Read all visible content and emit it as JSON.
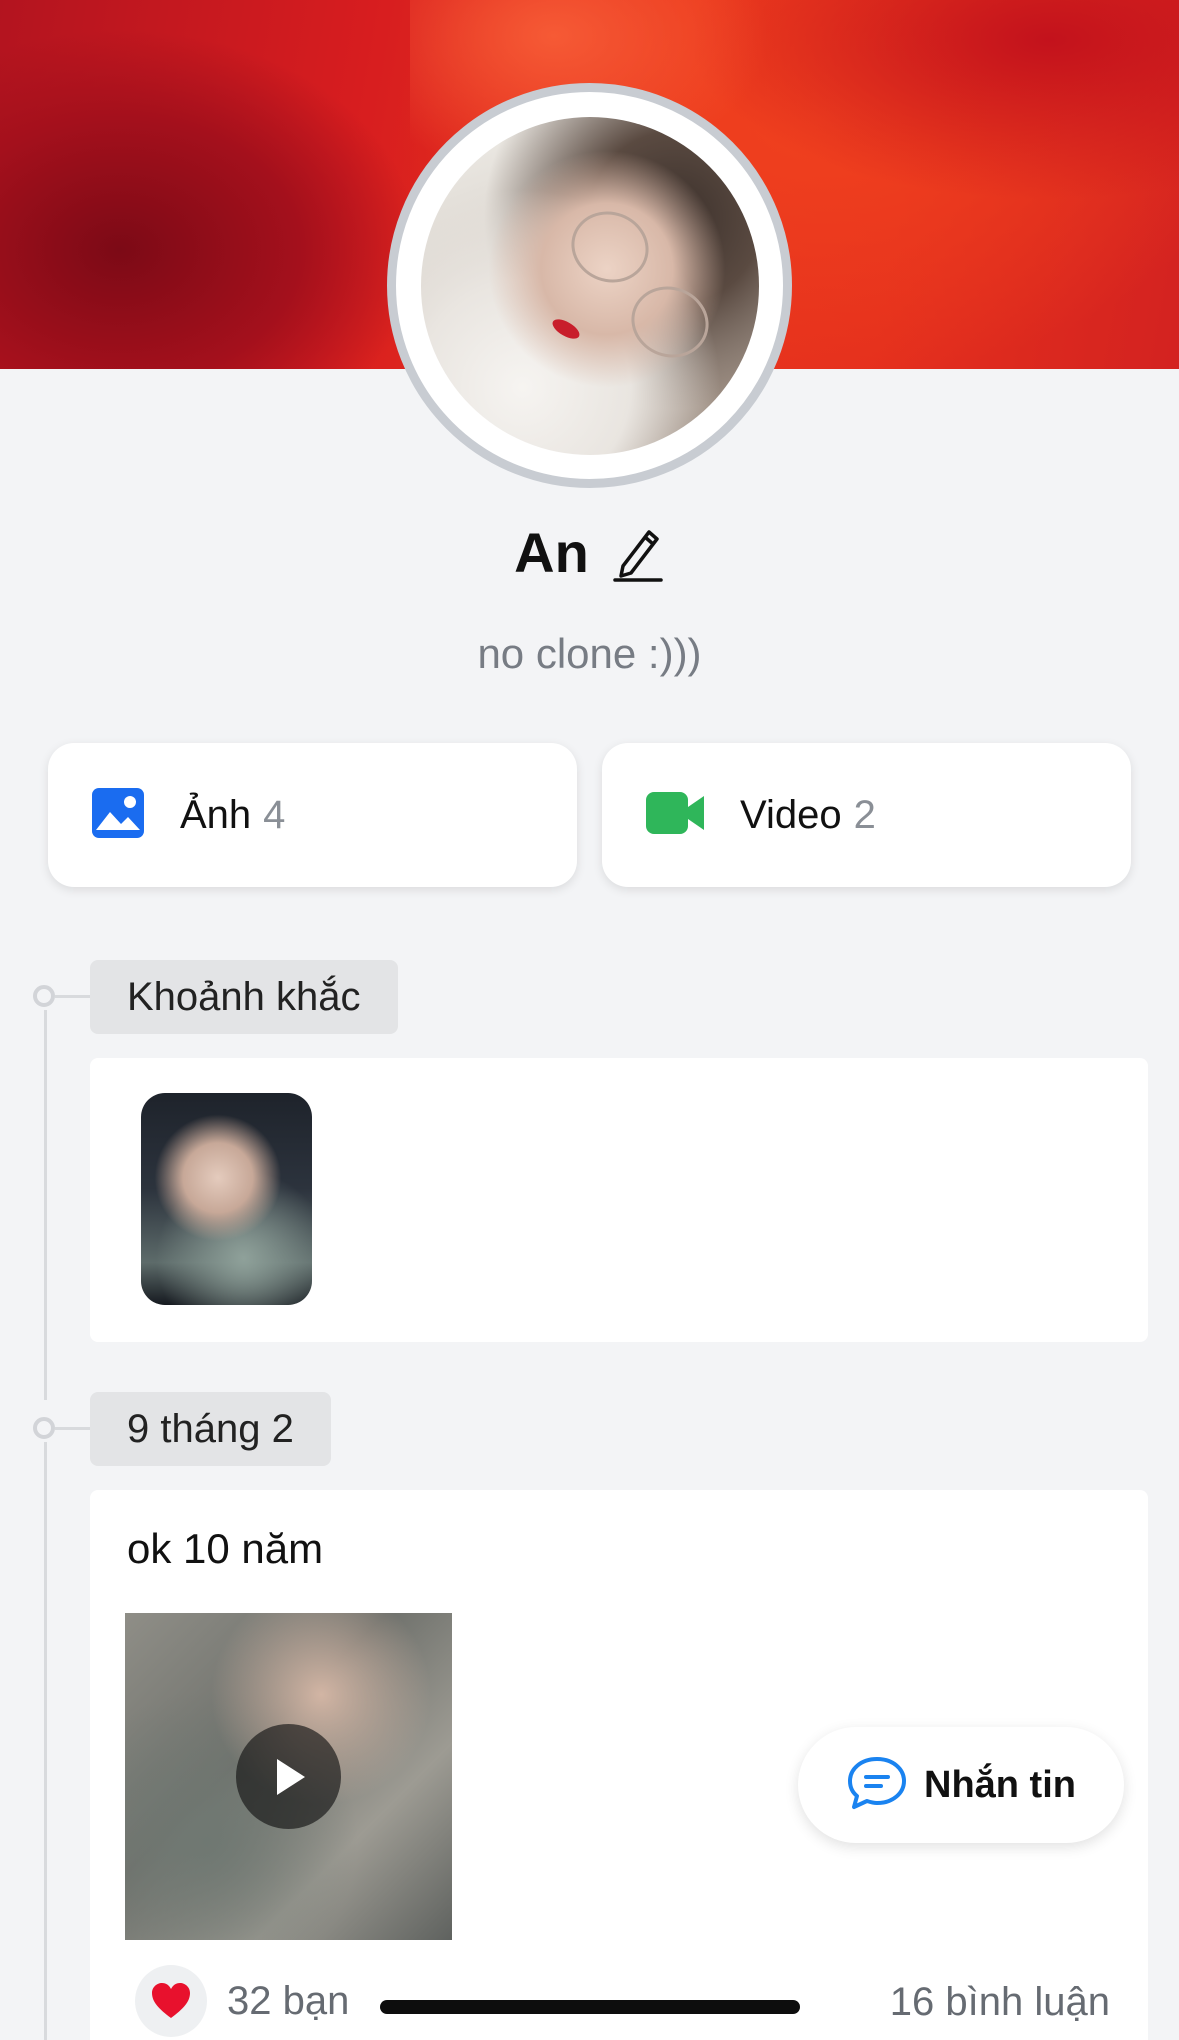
{
  "profile": {
    "name": "An",
    "status": "no clone :)))"
  },
  "media": {
    "photo_label": "Ảnh",
    "photo_count": "4",
    "video_label": "Video",
    "video_count": "2"
  },
  "timeline": {
    "moments_label": "Khoảnh khắc",
    "post_date": "9 tháng 2",
    "post_text": "ok 10 năm",
    "reaction_icon": "heart-emoji",
    "reaction_text": "32 bạn",
    "comments_text": "16 bình luận"
  },
  "actions": {
    "message_label": "Nhắn tin"
  },
  "colors": {
    "photo_icon": "#1a6cf0",
    "video_icon": "#2fb65a",
    "chat_icon": "#1a83f0",
    "heart": "#e8112d"
  }
}
